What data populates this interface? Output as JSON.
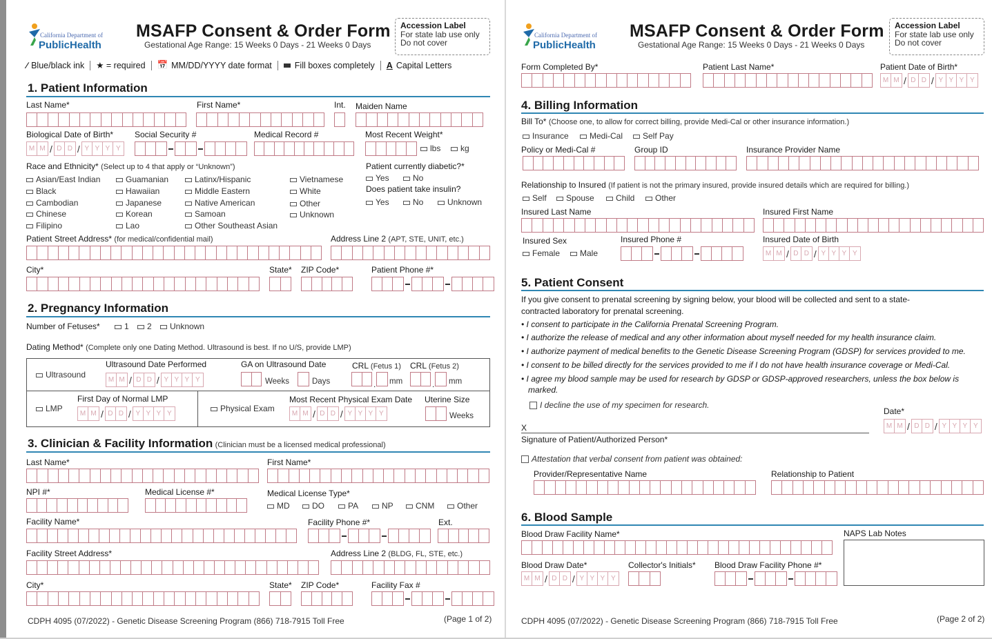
{
  "header": {
    "title": "MSAFP Consent & Order Form",
    "subtitle": "Gestational Age Range: 15 Weeks 0 Days  - 21 Weeks 0 Days",
    "logo_dept": "California Department of",
    "logo_name": "PublicHealth",
    "accession_title": "Accession Label",
    "accession_line1": "For state lab use only",
    "accession_line2": "Do not cover"
  },
  "legend": {
    "ink": "Blue/black ink",
    "required": "★ = required",
    "date": "MM/DD/YYYY date format",
    "fill": "Fill boxes completely",
    "caps": "Capital Letters"
  },
  "date_ph": {
    "m": "M",
    "d": "D",
    "y": "Y"
  },
  "s1": {
    "title": "1. Patient Information",
    "last": "Last Name*",
    "first": "First Name*",
    "int": "Int.",
    "maiden": "Maiden Name",
    "dob": "Biological Date of Birth*",
    "ssn": "Social Security #",
    "mrn": "Medical Record #",
    "weight": "Most Recent Weight*",
    "lbs": "lbs",
    "kg": "kg",
    "race_label": "Race and Ethnicity*",
    "race_note": "(Select up to 4 that apply or “Unknown”)",
    "races": [
      "Asian/East Indian",
      "Black",
      "Cambodian",
      "Chinese",
      "Filipino",
      "Guamanian",
      "Hawaiian",
      "Japanese",
      "Korean",
      "Lao",
      "Latinx/Hispanic",
      "Middle Eastern",
      "Native American",
      "Samoan",
      "Other Southeast Asian",
      "Vietnamese",
      "White",
      "Other",
      "Unknown"
    ],
    "diabetic": "Patient currently diabetic?*",
    "yes": "Yes",
    "no": "No",
    "insulin": "Does patient take insulin?",
    "unknown": "Unknown",
    "street": "Patient Street Address*",
    "street_note": "(for medical/confidential mail)",
    "addr2": "Address Line 2",
    "addr2_note": "(APT, STE, UNIT, etc.)",
    "city": "City*",
    "state": "State*",
    "zip": "ZIP Code*",
    "phone": "Patient Phone #*"
  },
  "s2": {
    "title": "2. Pregnancy Information",
    "fetuses": "Number of Fetuses*",
    "f1": "1",
    "f2": "2",
    "funk": "Unknown",
    "dating": "Dating Method*",
    "dating_note": "(Complete only one Dating Method. Ultrasound is best.  If no U/S, provide LMP)",
    "us": "Ultrasound",
    "us_date": "Ultrasound Date Performed",
    "ga": "GA on Ultrasound Date",
    "weeks": "Weeks",
    "days": "Days",
    "crl1": "CRL",
    "crl1n": "(Fetus 1)",
    "crl2": "CRL",
    "crl2n": "(Fetus 2)",
    "mm": "mm",
    "lmp": "LMP",
    "lmp_first": "First Day of Normal LMP",
    "pe": "Physical Exam",
    "pe_date": "Most Recent Physical Exam Date",
    "uterine": "Uterine Size"
  },
  "s3": {
    "title": "3. Clinician & Facility Information",
    "note": "(Clinician must be a licensed medical professional)",
    "last": "Last Name*",
    "first": "First Name*",
    "npi": "NPI #*",
    "lic": "Medical License #*",
    "lic_type": "Medical License Type*",
    "types": [
      "MD",
      "DO",
      "PA",
      "NP",
      "CNM",
      "Other"
    ],
    "fac": "Facility Name*",
    "fac_phone": "Facility Phone #*",
    "ext": "Ext.",
    "fac_street": "Facility Street Address*",
    "addr2": "Address Line 2",
    "addr2_note": "(BLDG, FL, STE, etc.)",
    "city": "City*",
    "state": "State*",
    "zip": "ZIP Code*",
    "fax": "Facility Fax #"
  },
  "footer1": {
    "left": "CDPH 4095 (07/2022) - Genetic Disease Screening Program (866) 718-7915 Toll Free",
    "right": "(Page 1 of 2)"
  },
  "p2": {
    "completed_by": "Form Completed By*",
    "pt_last": "Patient Last Name*",
    "pt_dob": "Patient Date of Birth*"
  },
  "s4": {
    "title": "4. Billing Information",
    "bill_to": "Bill To*",
    "bill_note": "(Choose one, to allow for correct billing, provide Medi-Cal or other insurance information.)",
    "opts": [
      "Insurance",
      "Medi-Cal",
      "Self Pay"
    ],
    "policy": "Policy or Medi-Cal #",
    "group": "Group ID",
    "provider": "Insurance Provider Name",
    "rel": "Relationship to Insured",
    "rel_note": "(If patient is not the primary insured, provide insured details which are required for billing.)",
    "rel_opts": [
      "Self",
      "Spouse",
      "Child",
      "Other"
    ],
    "ins_last": "Insured Last Name",
    "ins_first": "Insured First Name",
    "sex": "Insured Sex",
    "female": "Female",
    "male": "Male",
    "ins_phone": "Insured Phone #",
    "ins_dob": "Insured Date of Birth"
  },
  "s5": {
    "title": "5. Patient Consent",
    "intro1": "If you give consent to prenatal screening by signing below, your blood will be collected and sent to a state-",
    "intro2": "contracted laboratory for prenatal screening.",
    "b1": "I consent to participate in the California Prenatal Screening Program.",
    "b2": "I authorize the release of medical and any other information about myself needed for my health insurance claim.",
    "b3": "I authorize payment of medical benefits to the Genetic Disease Screening Program (GDSP) for services provided to me.",
    "b4": "I consent to be billed directly for the services provided to me if I do not have health insurance coverage or Medi-Cal.",
    "b5a": "I agree my blood sample may be used for research by GDSP or GDSP-approved researchers, unless the box below is",
    "b5b": "marked.",
    "decline": "I decline the use of my specimen for research.",
    "x": "X",
    "sig": "Signature of Patient/Authorized Person*",
    "date": "Date*",
    "attest": "Attestation that verbal consent from patient was obtained:",
    "prov": "Provider/Representative Name",
    "relpt": "Relationship to Patient"
  },
  "s6": {
    "title": "6. Blood Sample",
    "fac": "Blood Draw Facility Name*",
    "naps": "NAPS Lab Notes",
    "draw_date": "Blood Draw Date*",
    "init": "Collector's Initials*",
    "fac_phone": "Blood Draw Facility Phone #*"
  },
  "footer2": {
    "left": "CDPH 4095 (07/2022) - Genetic Disease Screening Program (866) 718-7915 Toll Free",
    "right": "(Page 2 of 2)"
  }
}
